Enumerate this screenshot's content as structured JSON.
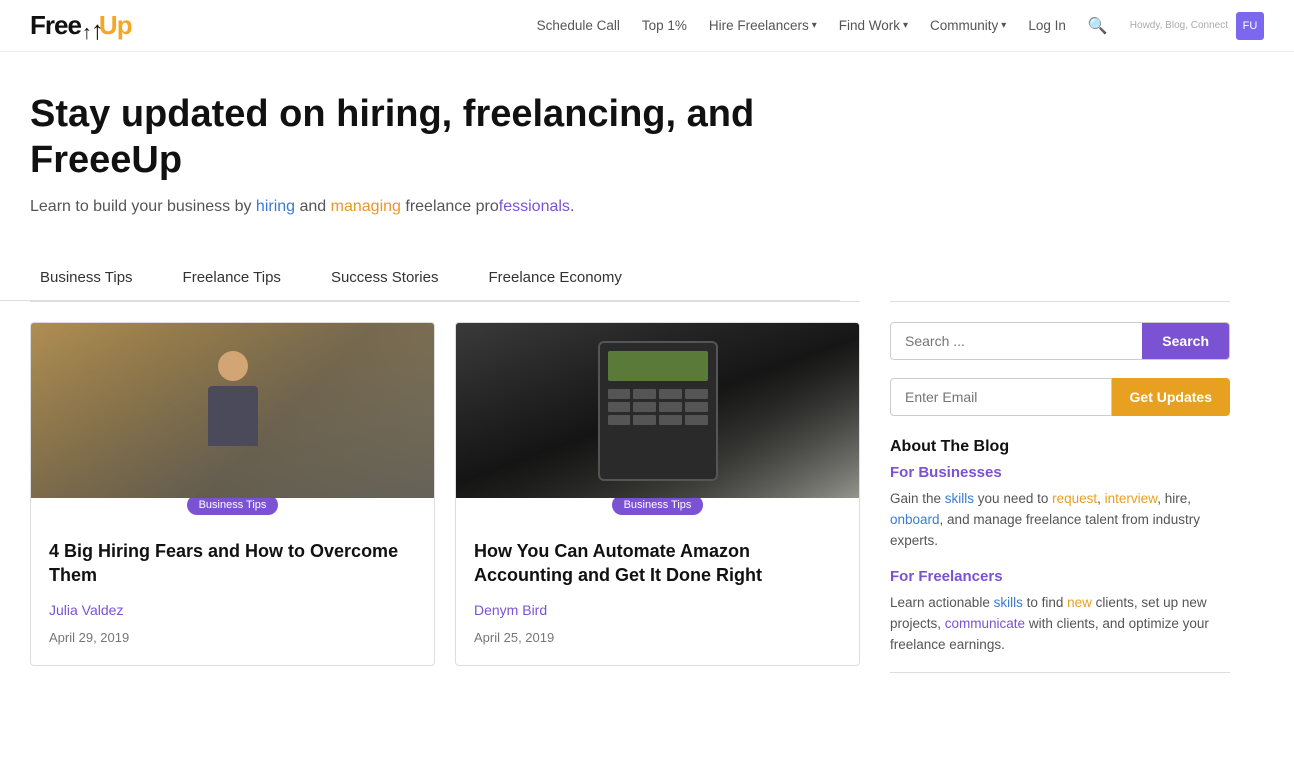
{
  "nav": {
    "logo_free": "Free",
    "logo_up": "Up",
    "links": [
      {
        "label": "Schedule Call",
        "id": "schedule-call"
      },
      {
        "label": "Top 1%",
        "id": "top-1"
      },
      {
        "label": "Hire Freelancers",
        "id": "hire-freelancers",
        "dropdown": true
      },
      {
        "label": "Find Work",
        "id": "find-work",
        "dropdown": true
      },
      {
        "label": "Community",
        "id": "community",
        "dropdown": true
      },
      {
        "label": "Log In",
        "id": "log-in"
      }
    ],
    "tiny_text": "Howdy, Blog, Connect",
    "avatar_text": "FU"
  },
  "hero": {
    "title": "Stay updated on hiring, freelancing, and FreeeUp",
    "subtitle_plain1": "Learn to build your business by ",
    "subtitle_blue": "hiring",
    "subtitle_plain2": " and ",
    "subtitle_orange": "managing",
    "subtitle_plain3": " freelance pro",
    "subtitle_purple": "fessionals",
    "subtitle_plain4": "."
  },
  "categories": [
    {
      "label": "Business Tips",
      "id": "business-tips"
    },
    {
      "label": "Freelance Tips",
      "id": "freelance-tips"
    },
    {
      "label": "Success Stories",
      "id": "success-stories"
    },
    {
      "label": "Freelance Economy",
      "id": "freelance-economy"
    }
  ],
  "articles": [
    {
      "id": "article-1",
      "tag": "Business Tips",
      "title": "4 Big Hiring Fears and How to Overcome Them",
      "author": "Julia Valdez",
      "date": "April 29, 2019",
      "image_type": "person"
    },
    {
      "id": "article-2",
      "tag": "Business Tips",
      "title": "How You Can Automate Amazon Accounting and Get It Done Right",
      "author": "Denym Bird",
      "date": "April 25, 2019",
      "image_type": "calculator"
    }
  ],
  "sidebar": {
    "search_placeholder": "Search ...",
    "search_button": "Search",
    "email_placeholder": "Enter Email",
    "email_button": "Get Updates",
    "about_title": "About The Blog",
    "for_businesses_title": "For Businesses",
    "for_businesses_text": "Gain the skills you need to request, interview, hire, onboard, and manage freelance talent from industry experts.",
    "for_freelancers_title": "For Freelancers",
    "for_freelancers_text": "Learn actionable skills to find new clients, set up new projects, communicate with clients, and optimize your freelance earnings."
  }
}
